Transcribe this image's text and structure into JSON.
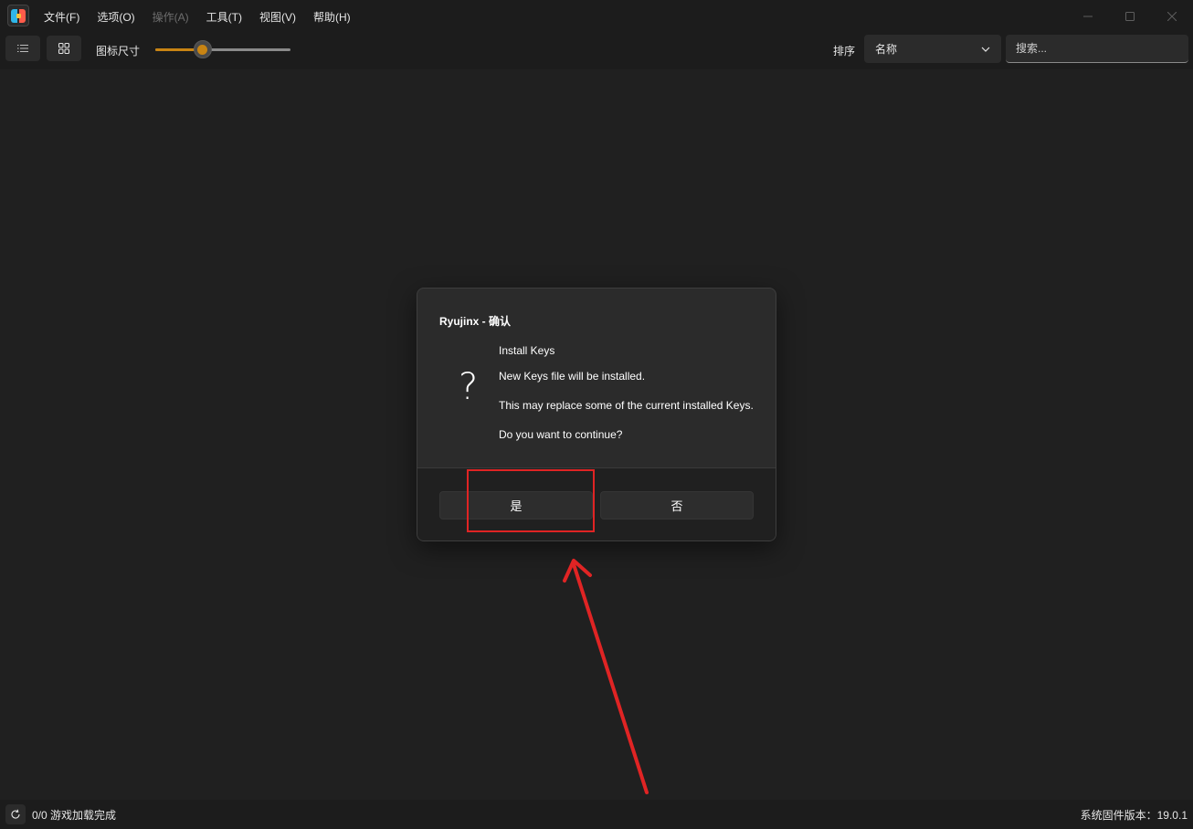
{
  "menubar": {
    "items": [
      {
        "label": "文件(F)",
        "enabled": true
      },
      {
        "label": "选项(O)",
        "enabled": true
      },
      {
        "label": "操作(A)",
        "enabled": false
      },
      {
        "label": "工具(T)",
        "enabled": true
      },
      {
        "label": "视图(V)",
        "enabled": true
      },
      {
        "label": "帮助(H)",
        "enabled": true
      }
    ],
    "window_controls": {
      "minimize": "minimize-icon",
      "maximize": "maximize-icon",
      "close": "close-icon"
    }
  },
  "toolbar": {
    "list_view_icon": "list-icon",
    "grid_view_icon": "grid-icon",
    "icon_size_label": "图标尺寸",
    "icon_size_level": 0.35,
    "sort_label": "排序",
    "sort_value": "名称",
    "search_placeholder": "搜索..."
  },
  "dialog": {
    "title": "Ryujinx - 确认",
    "icon": "question-icon",
    "heading": "Install Keys",
    "line1": "New Keys file will be installed.",
    "line2": "This may replace some of the current installed Keys.",
    "line3": "Do you want to continue?",
    "yes_label": "是",
    "no_label": "否"
  },
  "statusbar": {
    "games_loaded": "0/0 游戏加载完成",
    "firmware_version": "系统固件版本：19.0.1"
  },
  "colors": {
    "accent": "#c88413",
    "annotation": "#e02424",
    "background": "#202020"
  }
}
